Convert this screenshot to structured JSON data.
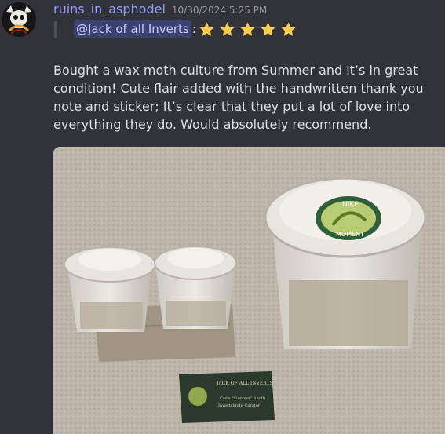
{
  "message": {
    "username": "ruins_in_asphodel",
    "timestamp": "10/30/2024 5:25 PM",
    "quote": {
      "mention": "@Jack of all Inverts",
      "separator": ":",
      "star_count": 5
    },
    "body": "Bought a wax moth culture from Summer and it’s in great condition! Cute flair added with the handwritten thank you note and sticker; It’s clear that they put a lot of love into everything they do. Would absolutely recommend."
  },
  "attachment": {
    "sticker_text_top": "NIKE",
    "sticker_text_bottom": "MOMENT",
    "card_title": "JACK OF ALL INVERTS",
    "card_name": "Carla \"Summer\" Smith",
    "card_role": "Invertebrate Curator"
  },
  "colors": {
    "username": "#949cf7",
    "mention_bg": "#3c4270",
    "star": "#ffcc4d"
  }
}
